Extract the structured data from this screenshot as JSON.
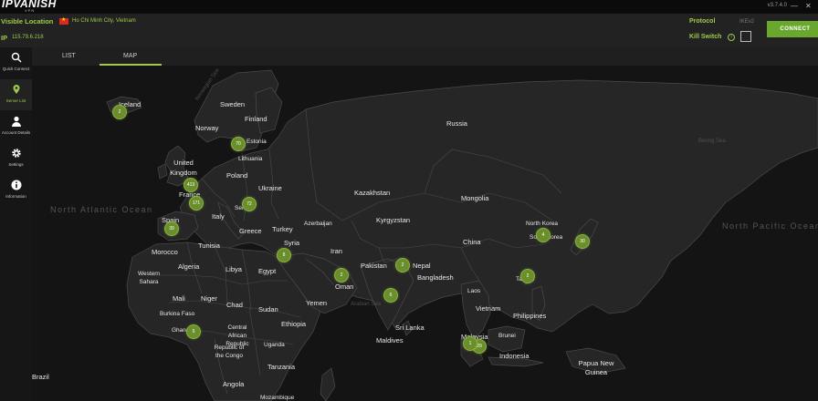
{
  "app": {
    "logo": "IPVANISH",
    "logo_sub": "VPN",
    "version": "v3.7.4.0",
    "win_min": "—",
    "win_close": "✕"
  },
  "header": {
    "visible_location_label": "Visible Location",
    "visible_location_city": "Ho Chi Minh City, Vietnam",
    "ip_label": "IP",
    "ip_value": "115.79.6.218",
    "protocol_label": "Protocol",
    "protocol_value": "IKEv2",
    "kill_switch_label": "Kill Switch",
    "info_glyph": "i",
    "connect_label": "CONNECT",
    "accent_color": "#9ccb4a",
    "connect_color": "#6aa72e"
  },
  "sidebar": {
    "items": [
      {
        "label": "Quick Connect",
        "icon": "search-icon"
      },
      {
        "label": "Server List",
        "icon": "location-pin-icon"
      },
      {
        "label": "Account Details",
        "icon": "user-icon"
      },
      {
        "label": "Settings",
        "icon": "gear-icon"
      },
      {
        "label": "Information",
        "icon": "info-icon"
      }
    ]
  },
  "tabs": [
    {
      "label": "LIST",
      "active": false
    },
    {
      "label": "MAP",
      "active": true
    }
  ],
  "map": {
    "countries": [
      "Iceland",
      "Norway",
      "Sweden",
      "Finland",
      "Russia",
      "Estonia",
      "Lithuania",
      "United Kingdom",
      "Poland",
      "Ukraine",
      "France",
      "Italy",
      "Serbia",
      "Greece",
      "Turkey",
      "Azerbaijan",
      "Kazakhstan",
      "Mongolia",
      "Kyrgyzstan",
      "China",
      "North Korea",
      "South Korea",
      "Spain",
      "Tunisia",
      "Syria",
      "Iran",
      "Morocco",
      "Algeria",
      "Libya",
      "Egypt",
      "Pakistan",
      "Nepal",
      "Bangladesh",
      "Taiwan",
      "Western Sahara",
      "Mali",
      "Niger",
      "Chad",
      "Sudan",
      "Oman",
      "Yemen",
      "Laos",
      "Vietnam",
      "Philippines",
      "Burkina Faso",
      "Ghana",
      "Central African Republic",
      "Ethiopia",
      "Republic of the Congo",
      "Uganda",
      "Tanzania",
      "Sri Lanka",
      "Maldives",
      "Malaysia",
      "Brunei",
      "Indonesia",
      "Papua New Guinea",
      "Angola",
      "Mozambique",
      "Brazil"
    ],
    "oceans": [
      "North Atlantic Ocean",
      "North Pacific Ocean"
    ],
    "seas": [
      "Norwegian Sea",
      "Bering Sea",
      "Arabian Sea"
    ],
    "clusters": [
      "2",
      "70",
      "413",
      "72",
      "171",
      "39",
      "8",
      "2",
      "2",
      "6",
      "4",
      "30",
      "2",
      "5",
      "29",
      "1"
    ]
  }
}
